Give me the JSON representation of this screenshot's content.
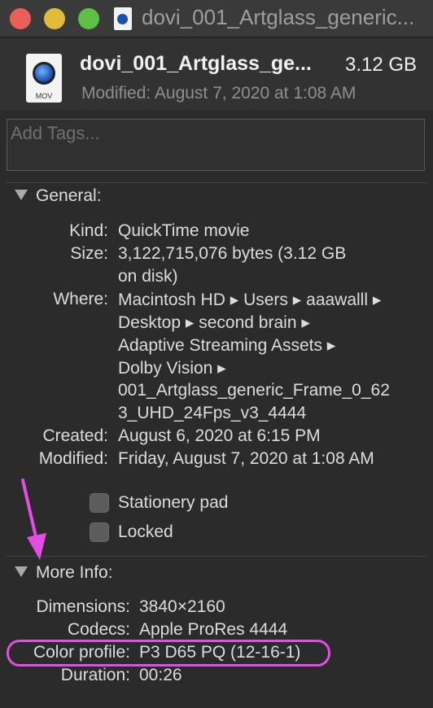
{
  "window": {
    "title": "dovi_001_Artglass_generic..."
  },
  "header": {
    "icon_ext": "MOV",
    "file_name": "dovi_001_Artglass_ge...",
    "size": "3.12 GB",
    "modified": "Modified: August 7, 2020 at 1:08 AM"
  },
  "tags": {
    "placeholder": "Add Tags..."
  },
  "general": {
    "heading": "General:",
    "kind_label": "Kind:",
    "kind": "QuickTime movie",
    "size_label": "Size:",
    "size_line1": "3,122,715,076 bytes (3.12 GB",
    "size_line2": "on disk)",
    "where_label": "Where:",
    "where_lines": [
      "Macintosh HD ▸ Users ▸ aaawalll ▸",
      "Desktop ▸ second brain ▸",
      "Adaptive Streaming Assets ▸",
      "Dolby Vision ▸",
      "001_Artglass_generic_Frame_0_62",
      "3_UHD_24Fps_v3_4444"
    ],
    "created_label": "Created:",
    "created": "August 6, 2020 at 6:15 PM",
    "modified_label": "Modified:",
    "modified": "Friday, August 7, 2020 at 1:08 AM",
    "stationery_label": "Stationery pad",
    "locked_label": "Locked"
  },
  "more_info": {
    "heading": "More Info:",
    "dimensions_label": "Dimensions:",
    "dimensions": "3840×2160",
    "codecs_label": "Codecs:",
    "codecs": "Apple ProRes 4444",
    "color_profile_label": "Color profile:",
    "color_profile": "P3 D65 PQ (12-16-1)",
    "duration_label": "Duration:",
    "duration": "00:26"
  },
  "colors": {
    "annotation": "#e44ce6",
    "close": "#ec5f58",
    "minimize": "#e1bb3a",
    "maximize": "#5fc048"
  }
}
